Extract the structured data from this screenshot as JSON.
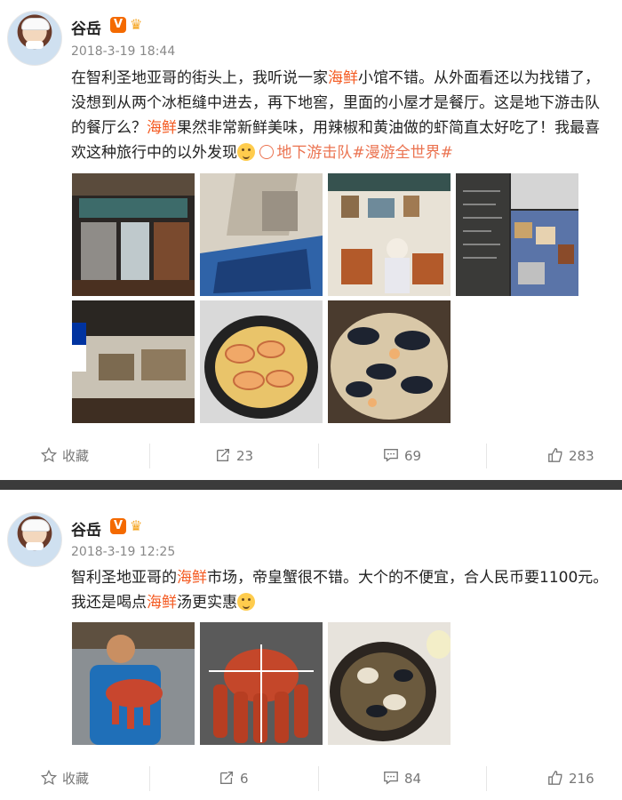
{
  "post1": {
    "author": "谷岳",
    "vip_badge": "V",
    "time": "2018-3-19 18:44",
    "text_parts": [
      "在智利圣地亚哥的街头上，我听说一家",
      "海鲜",
      "小馆不错。从外面看还以为找错了，没想到从两个冰柜缝中进去，再下地窖，里面的小屋才是餐厅。这是地下游击队的餐厅么？",
      "海鲜",
      "果然非常新鲜美味，用辣椒和黄油做的虾简直太好吃了！我最喜欢这种旅行中的以外发现"
    ],
    "topic": "地下游击队#漫游全世界#",
    "actions": {
      "fav": "收藏",
      "repost": "23",
      "comment": "69",
      "like": "283"
    }
  },
  "post2": {
    "author": "谷岳",
    "vip_badge": "V",
    "time": "2018-3-19 12:25",
    "text_parts": [
      "智利圣地亚哥的",
      "海鲜",
      "市场，帝皇蟹很不错。大个的不便宜，合人民币要1100元。我还是喝点",
      "海鲜",
      "汤更实惠"
    ],
    "actions": {
      "fav": "收藏",
      "repost": "6",
      "comment": "84",
      "like": "216"
    }
  },
  "icons": [
    "star-icon",
    "repost-icon",
    "comment-icon",
    "thumbs-up-icon",
    "topic-icon",
    "crown-icon",
    "laugh-emoji-icon",
    "tongue-emoji-icon"
  ],
  "colors": {
    "highlight": "#f45a21",
    "topic": "#eb7350",
    "vip": "#f46a00",
    "separator": "#3b3b3b"
  }
}
